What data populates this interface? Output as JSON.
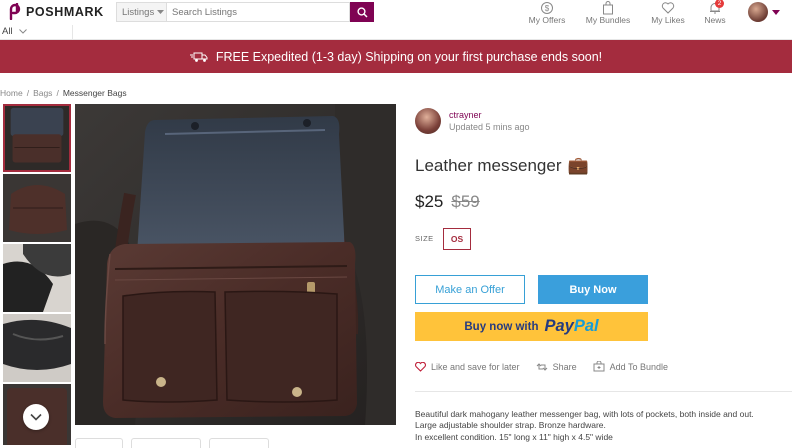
{
  "header": {
    "logo_text": "POSHMARK",
    "listing_select": "Listings",
    "search_placeholder": "Search Listings",
    "nav": [
      {
        "label": "My Offers",
        "icon": "offers-icon"
      },
      {
        "label": "My Bundles",
        "icon": "bundle-icon"
      },
      {
        "label": "My Likes",
        "icon": "heart-icon"
      },
      {
        "label": "News",
        "icon": "bell-icon",
        "badge": "2"
      }
    ]
  },
  "subnav": {
    "all_label": "All"
  },
  "banner": {
    "text": "FREE Expedited (1-3 day) Shipping on your first purchase ends soon!"
  },
  "breadcrumb": {
    "home": "Home",
    "sep1": "/",
    "bags": "Bags",
    "sep2": "/",
    "current": "Messenger Bags"
  },
  "seller": {
    "name": "ctrayner",
    "updated": "Updated 5 mins ago"
  },
  "listing": {
    "title": "Leather messenger",
    "title_emoji": "💼",
    "price": "$25",
    "original_price": "$59",
    "size_label": "SIZE",
    "size_value": "OS"
  },
  "buttons": {
    "make_offer": "Make an Offer",
    "buy_now": "Buy Now",
    "buy_with": "Buy now with",
    "paypal_pay": "Pay",
    "paypal_pal": "Pal"
  },
  "actions": {
    "like": "Like and save for later",
    "share": "Share",
    "bundle": "Add To Bundle"
  },
  "description": [
    "Beautiful dark mahogany leather messenger bag, with lots of pockets, both inside and out.",
    "Large adjustable shoulder strap. Bronze hardware.",
    "In excellent condition. 15\" long x 11\" high x 4.5\" wide"
  ],
  "colors": {
    "brand": "#7f0353",
    "banner": "#a42c3e",
    "buy_blue": "#3a9fdc",
    "paypal_yellow": "#ffc33a"
  }
}
